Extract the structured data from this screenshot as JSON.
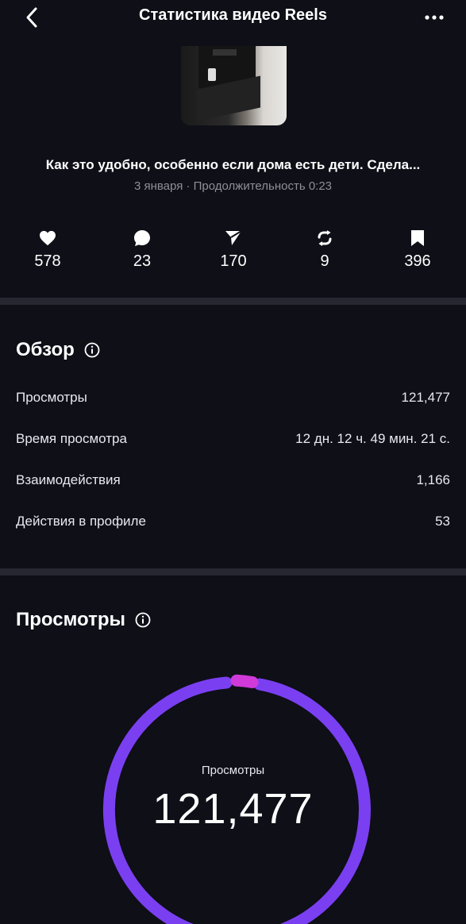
{
  "header": {
    "title": "Статистика видео Reels"
  },
  "video": {
    "title": "Как это удобно, особенно если дома есть дети. Сдела...",
    "meta": "3 января · Продолжительность 0:23"
  },
  "stats": {
    "likes": "578",
    "comments": "23",
    "shares": "170",
    "reposts": "9",
    "saves": "396"
  },
  "overview": {
    "title": "Обзор",
    "rows": [
      {
        "label": "Просмотры",
        "value": "121,477"
      },
      {
        "label": "Время просмотра",
        "value": "12 дн. 12 ч. 49 мин. 21 с."
      },
      {
        "label": "Взаимодействия",
        "value": "1,166"
      },
      {
        "label": "Действия в профиле",
        "value": "53"
      }
    ]
  },
  "views": {
    "title": "Просмотры",
    "donut_label": "Просмотры",
    "donut_value": "121,477",
    "donut_segments": [
      {
        "color": "#7b3ff2",
        "share": 0.985
      },
      {
        "color": "#d03ad8",
        "share": 0.015
      }
    ]
  },
  "colors": {
    "background": "#0e0f17",
    "divider": "#262731",
    "accent_purple": "#7b3ff2",
    "accent_magenta": "#d03ad8",
    "muted_text": "#8e8f99"
  }
}
